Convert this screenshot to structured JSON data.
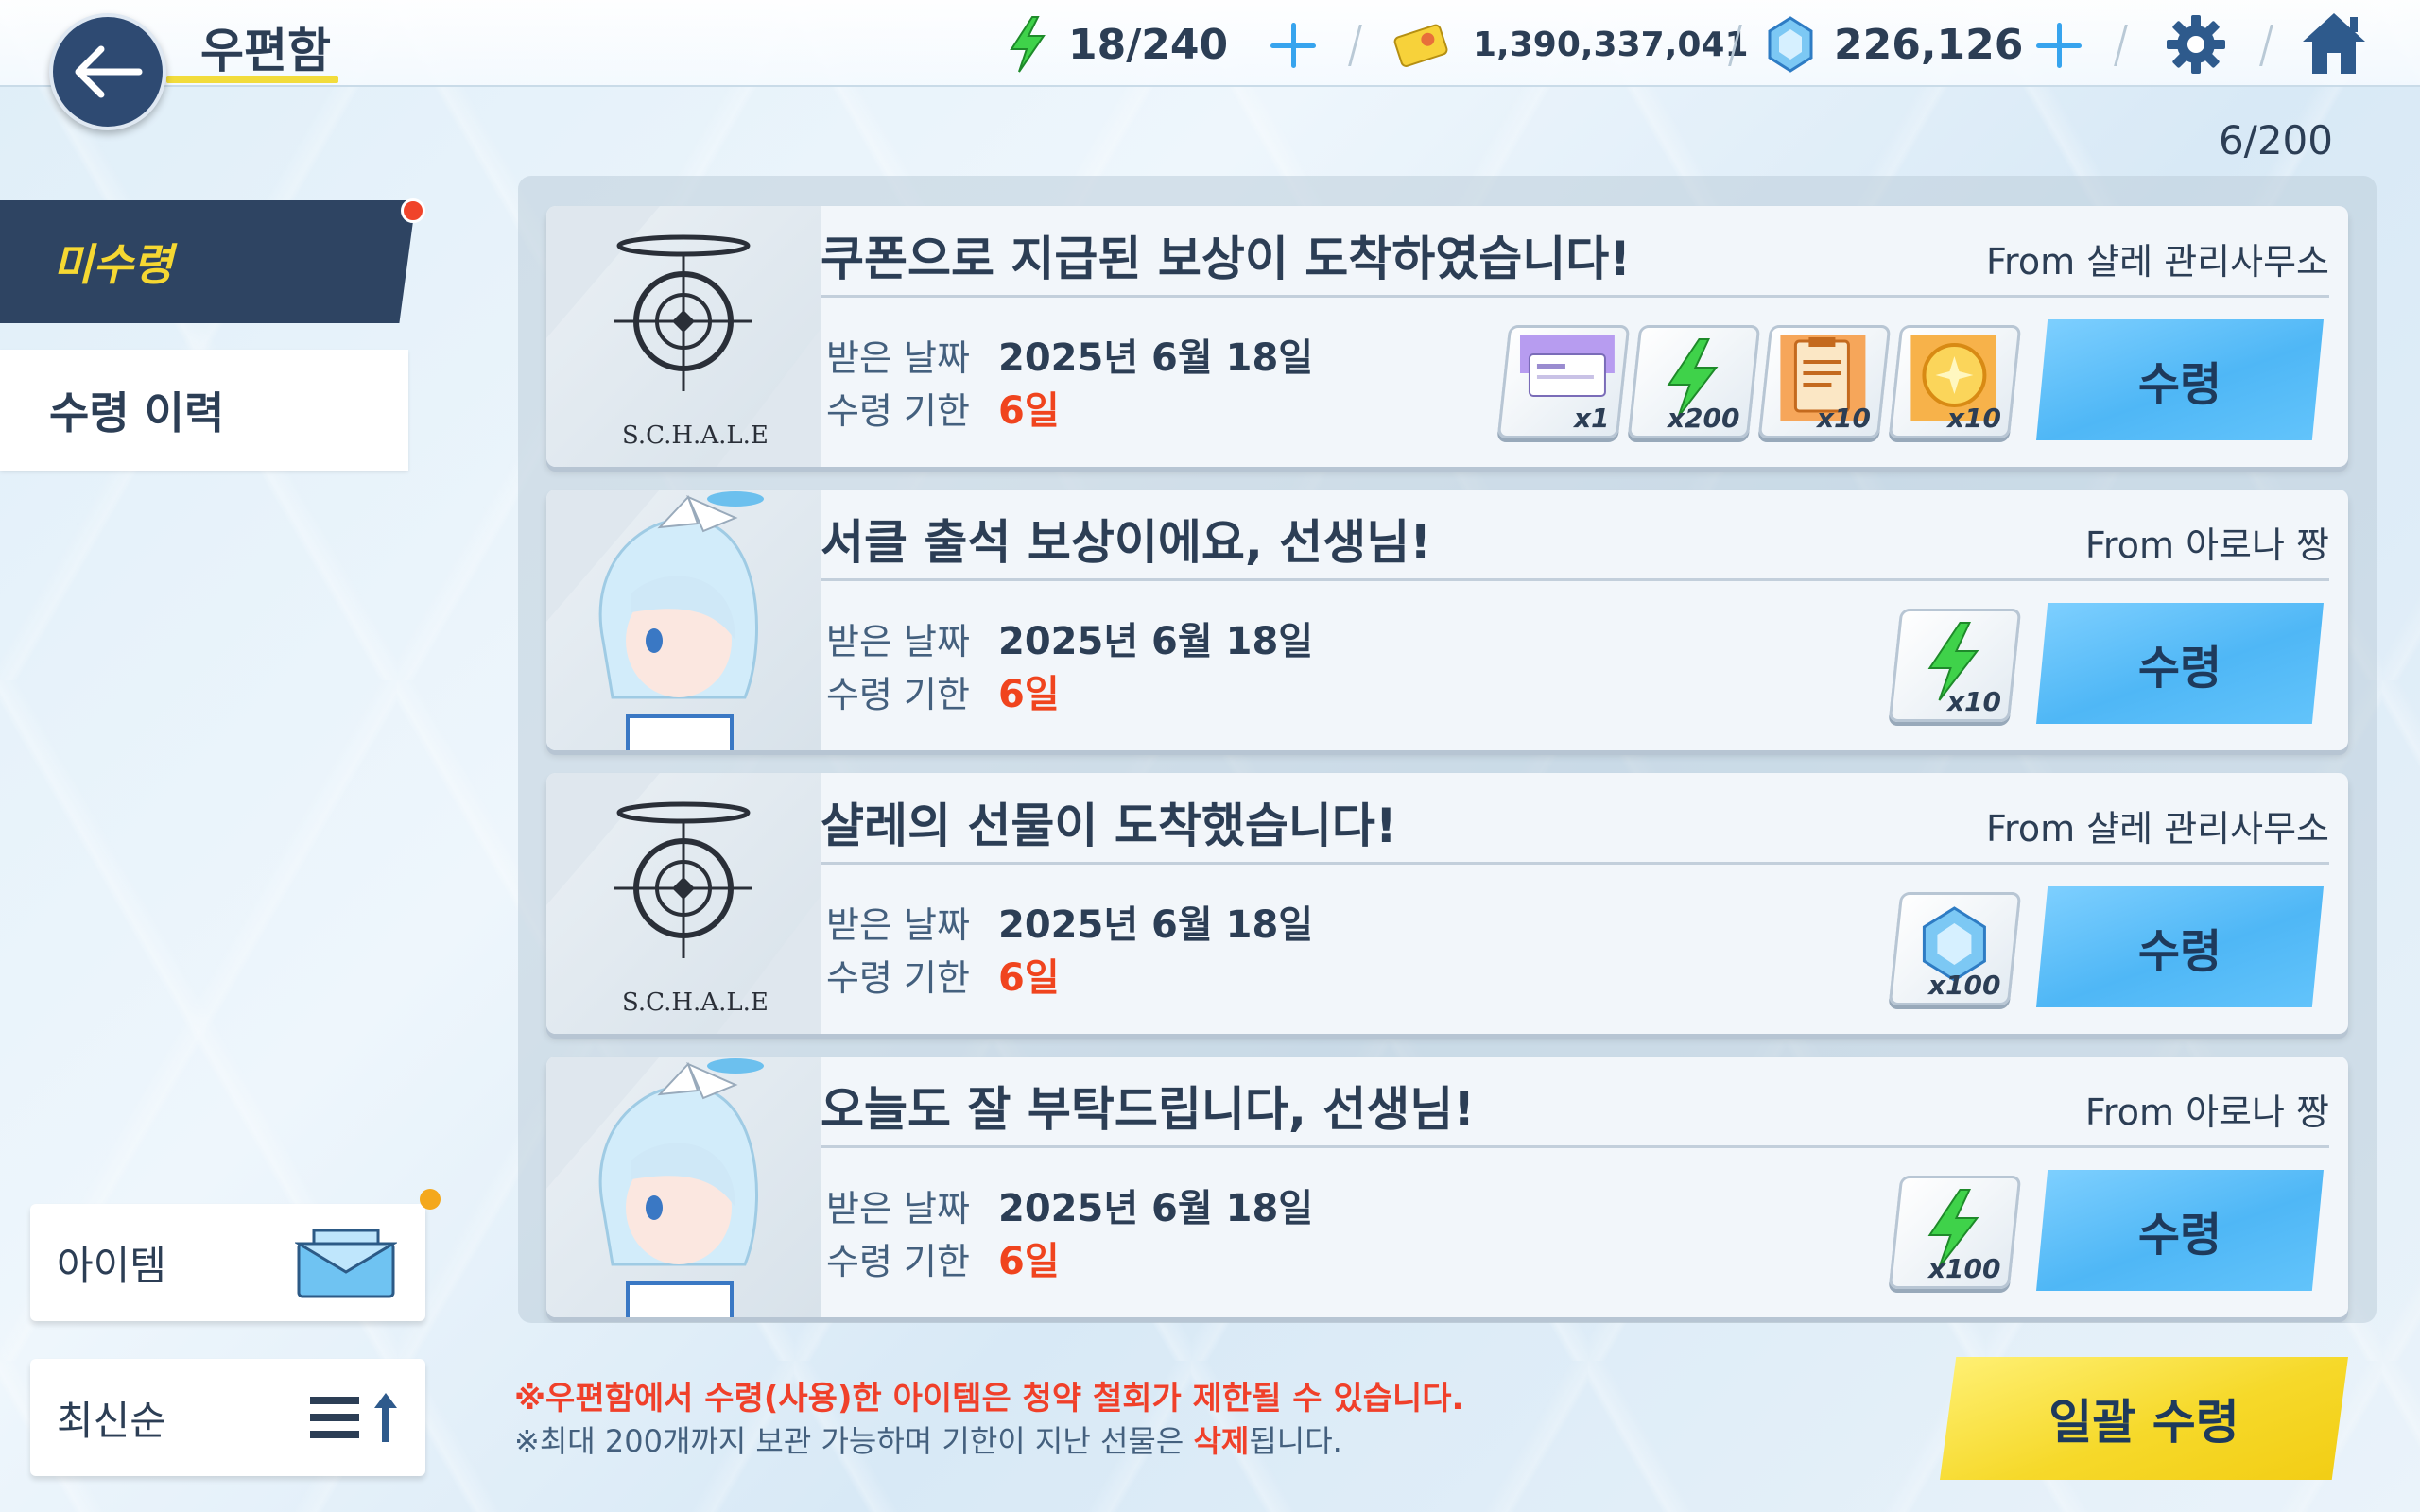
{
  "header": {
    "title": "우편함",
    "ap": "18/240",
    "credits": "1,390,337,041",
    "pyroxene": "226,126"
  },
  "sidebar": {
    "tabs": [
      {
        "label": "미수령",
        "active": true
      },
      {
        "label": "수령 이력",
        "active": false
      }
    ],
    "filter_label": "아이템",
    "sort_label": "최신순"
  },
  "mail_count": "6/200",
  "labels": {
    "received_date": "받은 날짜",
    "deadline": "수령 기한",
    "receive": "수령",
    "schale": "S.C.H.A.L.E"
  },
  "mails": [
    {
      "title": "쿠폰으로 지급된 보상이 도착하였습니다!",
      "from": "From 샬레 관리사무소",
      "date": "2025년 6월 18일",
      "deadline": "6일",
      "sender_icon": "schale-logo",
      "items": [
        {
          "icon": "ticket-icon",
          "qty": "x1"
        },
        {
          "icon": "ap-bolt-icon",
          "qty": "x200"
        },
        {
          "icon": "report-icon",
          "qty": "x10"
        },
        {
          "icon": "coin-icon",
          "qty": "x10"
        }
      ]
    },
    {
      "title": "서클 출석 보상이에요, 선생님!",
      "from": "From 아로나 짱",
      "date": "2025년 6월 18일",
      "deadline": "6일",
      "sender_icon": "arona-portrait",
      "items": [
        {
          "icon": "ap-bolt-icon",
          "qty": "x10"
        }
      ]
    },
    {
      "title": "샬레의 선물이 도착했습니다!",
      "from": "From 샬레 관리사무소",
      "date": "2025년 6월 18일",
      "deadline": "6일",
      "sender_icon": "schale-logo",
      "items": [
        {
          "icon": "pyroxene-icon",
          "qty": "x100"
        }
      ]
    },
    {
      "title": "오늘도 잘 부탁드립니다, 선생님!",
      "from": "From 아로나 짱",
      "date": "2025년 6월 18일",
      "deadline": "6일",
      "sender_icon": "arona-portrait",
      "items": [
        {
          "icon": "ap-bolt-icon",
          "qty": "x100"
        }
      ]
    }
  ],
  "footer": {
    "notice_red": "※우편함에서 수령(사용)한 아이템은 청약 철회가 제한될 수 있습니다.",
    "notice_gray_pre": "※최대 200개까지 보관 가능하며 기한이 지난 선물은 ",
    "notice_gray_em": "삭제",
    "notice_gray_post": "됩니다.",
    "bulk_label": "일괄 수령"
  },
  "colors": {
    "accent_blue": "#4fb7f6",
    "accent_yellow": "#f6d92a",
    "deadline_red": "#f0441e",
    "nav_dark": "#2e4462"
  }
}
